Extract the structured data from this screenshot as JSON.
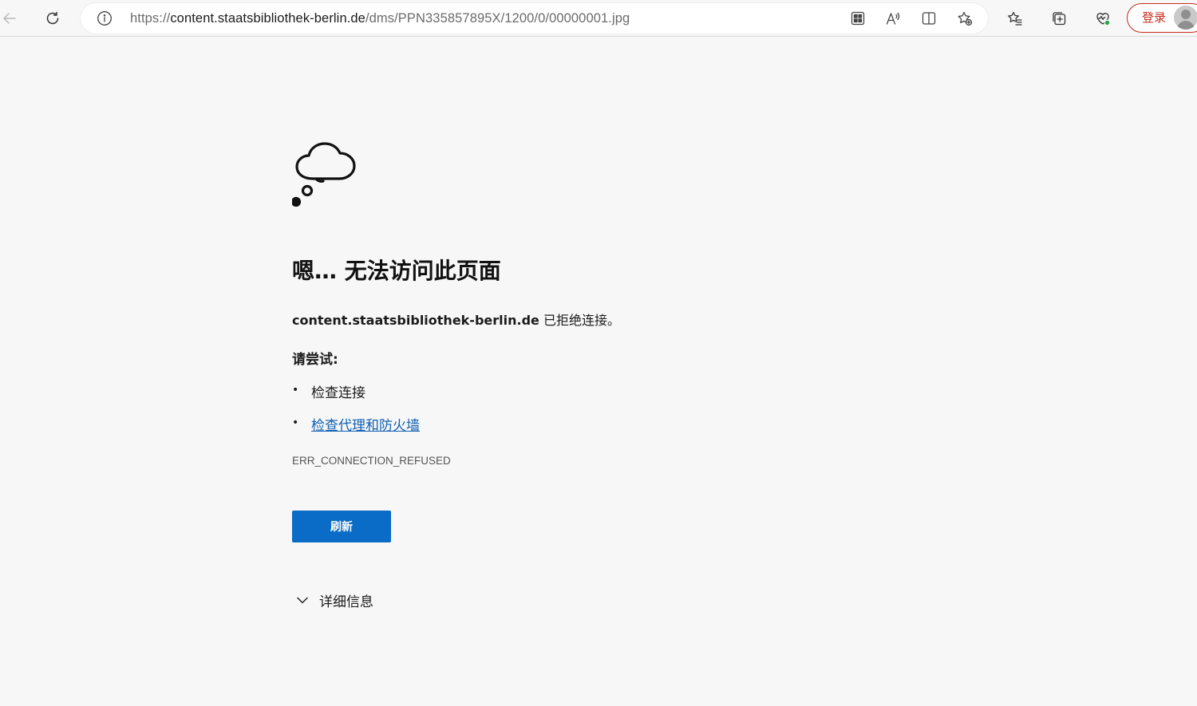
{
  "browser": {
    "url": {
      "protocol": "https://",
      "host": "content.staatsbibliothek-berlin.de",
      "path": "/dms/PPN335857895X/1200/0/00000001.jpg"
    },
    "signin_label": "登录"
  },
  "error_page": {
    "title": "嗯… 无法访问此页面",
    "host": "content.staatsbibliothek-berlin.de",
    "message_suffix": " 已拒绝连接。",
    "try_heading": "请尝试:",
    "suggestions": [
      {
        "text": "检查连接",
        "is_link": false
      },
      {
        "text": "检查代理和防火墙",
        "is_link": true
      }
    ],
    "error_code": "ERR_CONNECTION_REFUSED",
    "refresh_label": "刷新",
    "details_label": "详细信息"
  },
  "colors": {
    "accent": "#0a6cc7",
    "link": "#0f5fb3",
    "signin_border": "#c42b1c"
  }
}
